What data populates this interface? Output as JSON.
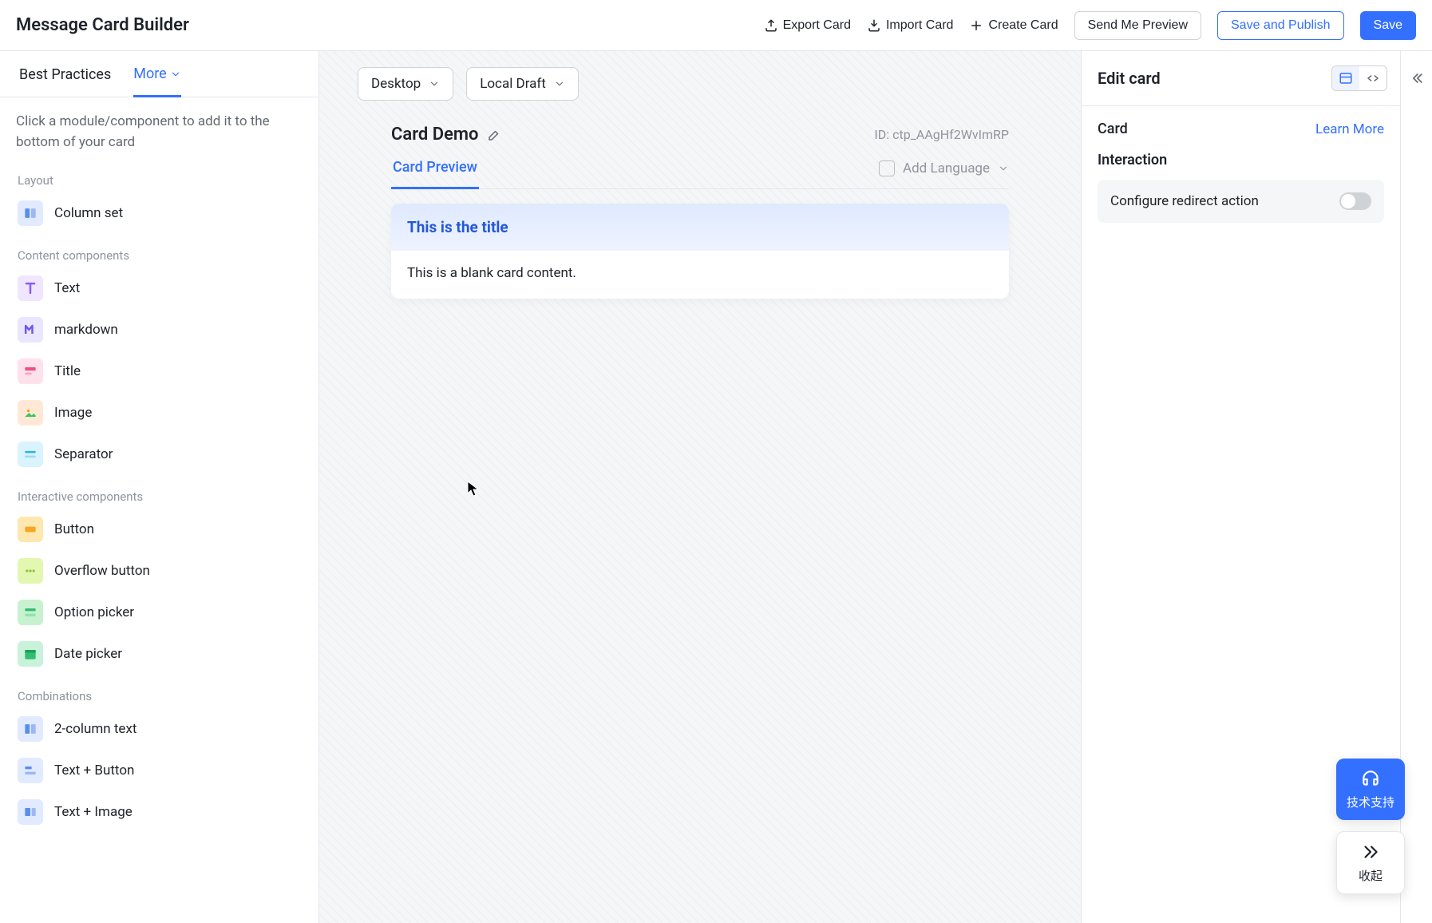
{
  "header": {
    "title": "Message Card Builder",
    "export": "Export Card",
    "import": "Import Card",
    "create": "Create Card",
    "send_preview": "Send Me Preview",
    "save_publish": "Save and Publish",
    "save": "Save"
  },
  "sidebar": {
    "tabs": {
      "best_practices": "Best Practices",
      "more": "More"
    },
    "hint": "Click a module/component to add it to the bottom of your card",
    "sections": {
      "layout": "Layout",
      "content": "Content components",
      "interactive": "Interactive components",
      "combinations": "Combinations"
    },
    "items": {
      "column_set": "Column set",
      "text": "Text",
      "markdown": "markdown",
      "title": "Title",
      "image": "Image",
      "separator": "Separator",
      "button": "Button",
      "overflow": "Overflow button",
      "option_picker": "Option picker",
      "date_picker": "Date picker",
      "two_col_text": "2-column text",
      "text_button": "Text + Button",
      "text_image": "Text + Image"
    }
  },
  "canvas": {
    "device": "Desktop",
    "draft": "Local Draft",
    "card_name": "Card Demo",
    "card_id_label": "ID:",
    "card_id": "ctp_AAgHf2WvImRP",
    "preview_tab": "Card Preview",
    "add_language": "Add Language",
    "card_title": "This is the title",
    "card_body": "This is a blank card content."
  },
  "panel": {
    "title": "Edit card",
    "card_label": "Card",
    "learn_more": "Learn More",
    "interaction": "Interaction",
    "configure_redirect": "Configure redirect action"
  },
  "float": {
    "support": "技术支持",
    "collapse": "收起"
  }
}
